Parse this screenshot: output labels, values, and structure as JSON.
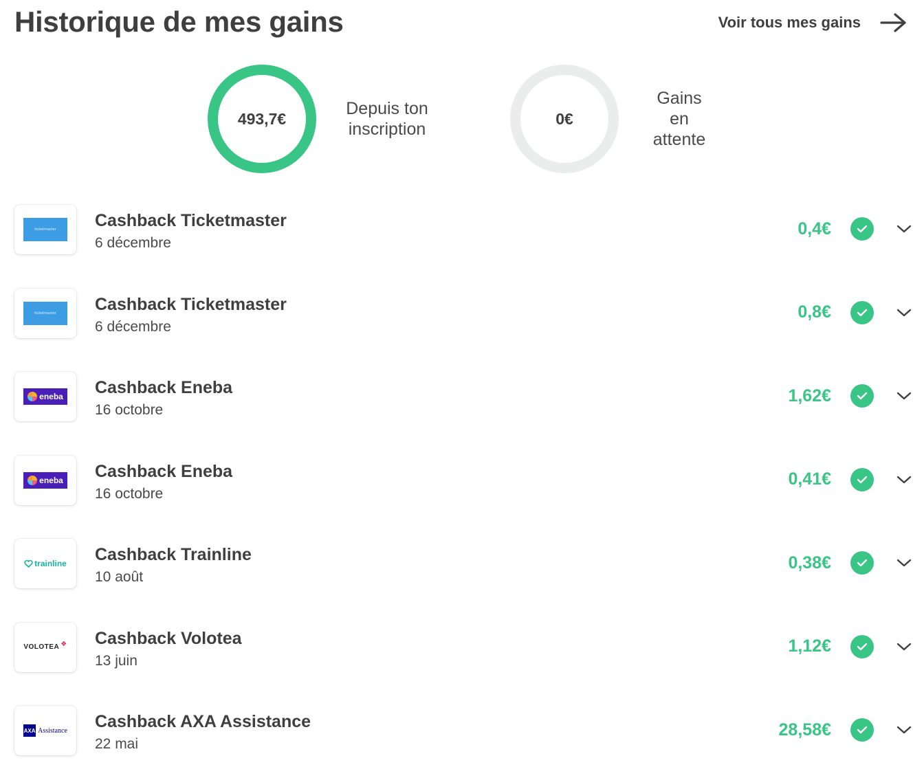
{
  "header": {
    "title": "Historique de mes gains",
    "see_all_label": "Voir tous mes gains",
    "see_all_icon": "arrow-right-icon"
  },
  "summary": {
    "total": {
      "value": "493,7€",
      "caption_line1": "Depuis ton",
      "caption_line2": "inscription",
      "ring_color": "#39c586"
    },
    "pending": {
      "value": "0€",
      "caption_line1": "Gains en",
      "caption_line2": "attente",
      "ring_color": "#ebecec"
    }
  },
  "colors": {
    "accent": "#39c586",
    "text": "#3f3f3f",
    "ticketmaster": "#3c9de5",
    "eneba": "#4a1fb8",
    "trainline": "#18b5a4",
    "axa": "#00008f"
  },
  "transactions": [
    {
      "merchant": "Ticketmaster",
      "logo_text": "ticketmaster",
      "title": "Cashback Ticketmaster",
      "date": "6 décembre",
      "amount": "0,4€",
      "status_icon": "check-circle-icon"
    },
    {
      "merchant": "Ticketmaster",
      "logo_text": "ticketmaster",
      "title": "Cashback Ticketmaster",
      "date": "6 décembre",
      "amount": "0,8€",
      "status_icon": "check-circle-icon"
    },
    {
      "merchant": "Eneba",
      "logo_text": "eneba",
      "title": "Cashback Eneba",
      "date": "16 octobre",
      "amount": "1,62€",
      "status_icon": "check-circle-icon"
    },
    {
      "merchant": "Eneba",
      "logo_text": "eneba",
      "title": "Cashback Eneba",
      "date": "16 octobre",
      "amount": "0,41€",
      "status_icon": "check-circle-icon"
    },
    {
      "merchant": "Trainline",
      "logo_text": "trainline",
      "title": "Cashback Trainline",
      "date": "10 août",
      "amount": "0,38€",
      "status_icon": "check-circle-icon"
    },
    {
      "merchant": "Volotea",
      "logo_text": "VOLOTEA",
      "title": "Cashback Volotea",
      "date": "13 juin",
      "amount": "1,12€",
      "status_icon": "check-circle-icon"
    },
    {
      "merchant": "AXA Assistance",
      "logo_text": "AXA",
      "logo_subtext": "Assistance",
      "title": "Cashback AXA Assistance",
      "date": "22 mai",
      "amount": "28,58€",
      "status_icon": "check-circle-icon"
    }
  ]
}
